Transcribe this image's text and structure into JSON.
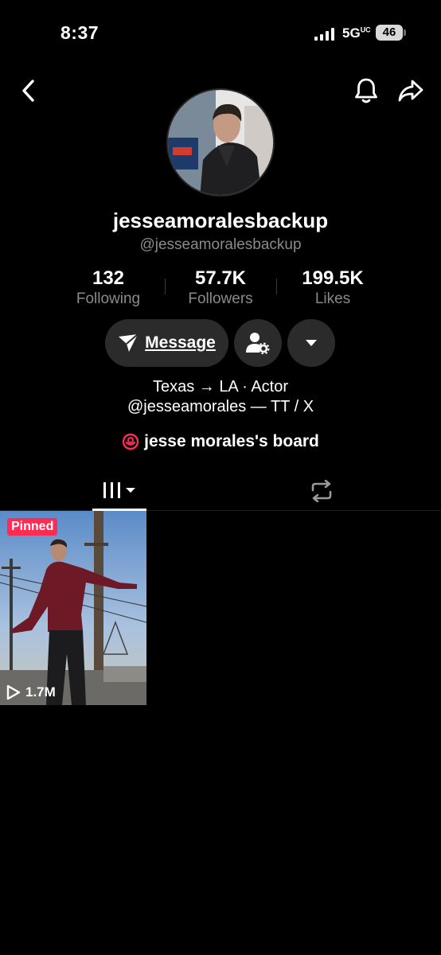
{
  "status": {
    "time": "8:37",
    "network": "5G",
    "network_suffix": "UC",
    "battery": "46"
  },
  "nav": {
    "back_icon": "chevron-left-icon",
    "bell_icon": "bell-icon",
    "share_icon": "share-arrow-icon"
  },
  "profile": {
    "display_name": "jesseamoralesbackup",
    "username": "@jesseamoralesbackup",
    "stats": [
      {
        "value": "132",
        "label": "Following"
      },
      {
        "value": "57.7K",
        "label": "Followers"
      },
      {
        "value": "199.5K",
        "label": "Likes"
      }
    ],
    "message_label": "Message",
    "bio_line1": "Texas → LA · Actor",
    "bio_line2": "@jesseamorales — TT / X",
    "board_label": "jesse morales's board"
  },
  "colors": {
    "accent": "#fe2c55",
    "background": "#000000",
    "button": "#2b2b2b",
    "secondary_text": "#8a8a8a"
  },
  "videos": [
    {
      "badge": "Pinned",
      "views": "1.7M"
    }
  ]
}
